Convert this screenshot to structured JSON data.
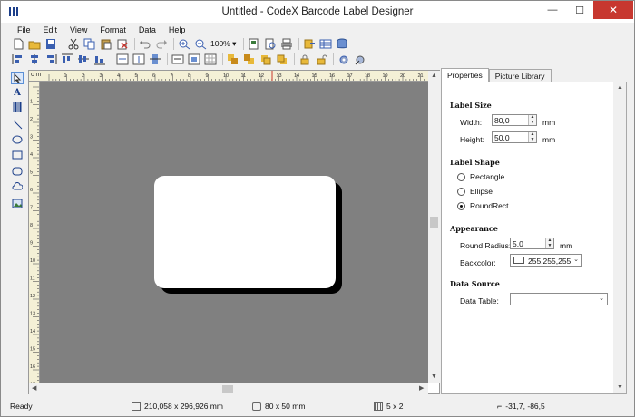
{
  "window": {
    "title": "Untitled - CodeX Barcode Label Designer",
    "min_glyph": "—",
    "max_glyph": "☐",
    "close_glyph": "✕"
  },
  "menu": [
    "File",
    "Edit",
    "View",
    "Format",
    "Data",
    "Help"
  ],
  "toolbar": {
    "zoom": "100%",
    "zoom_caret": "▾"
  },
  "rulers": {
    "unit": "c m",
    "top_numbers": [
      "1",
      "2",
      "3",
      "4",
      "5",
      "6",
      "7",
      "8",
      "9",
      "10",
      "11",
      "12",
      "13",
      "14",
      "15",
      "16",
      "17",
      "18",
      "19",
      "20",
      "21"
    ],
    "left_numbers": [
      "1",
      "2",
      "3",
      "4",
      "5",
      "6",
      "7",
      "8",
      "9",
      "10",
      "11",
      "12",
      "13",
      "14",
      "15",
      "16",
      "17"
    ]
  },
  "panel": {
    "tabs": [
      "Properties",
      "Picture Library"
    ],
    "label_size": {
      "heading": "Label Size",
      "width_label": "Width:",
      "width_value": "80,0",
      "width_unit": "mm",
      "height_label": "Height:",
      "height_value": "50,0",
      "height_unit": "mm"
    },
    "label_shape": {
      "heading": "Label Shape",
      "options": [
        "Rectangle",
        "Ellipse",
        "RoundRect"
      ],
      "selected": "RoundRect"
    },
    "appearance": {
      "heading": "Appearance",
      "radius_label": "Round Radius:",
      "radius_value": "5,0",
      "radius_unit": "mm",
      "backcolor_label": "Backcolor:",
      "backcolor_value": "255,255,255"
    },
    "data_source": {
      "heading": "Data Source",
      "table_label": "Data Table:",
      "table_value": ""
    }
  },
  "status": {
    "ready": "Ready",
    "page_size": "210,058 x 296,926 mm",
    "label_size": "80 x 50 mm",
    "grid": "5 x 2",
    "cursor": "-31,7, -86,5"
  },
  "colors": {
    "workarea": "#808080",
    "ruler": "#f4f0d6",
    "accent": "#1c3f8a",
    "close": "#c7372f"
  }
}
